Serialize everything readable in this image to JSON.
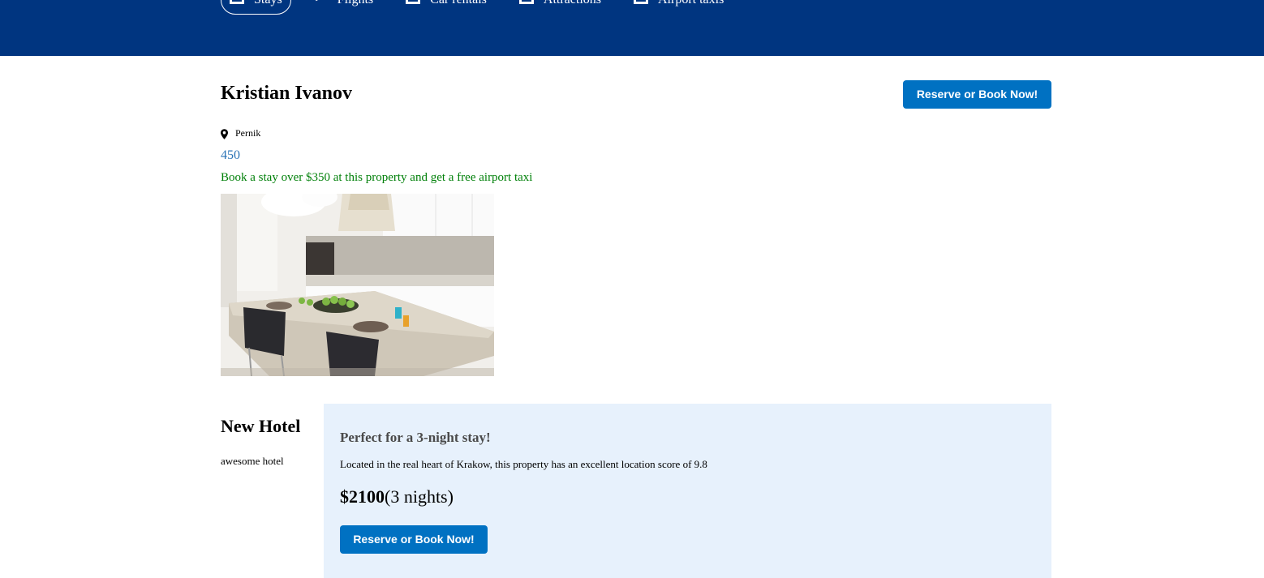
{
  "nav": {
    "items": [
      {
        "label": "Stays",
        "icon": "bed-icon",
        "active": true
      },
      {
        "label": "Flights",
        "icon": "plane-icon",
        "active": false
      },
      {
        "label": "Car rentals",
        "icon": "car-icon",
        "active": false
      },
      {
        "label": "Attractions",
        "icon": "attraction-icon",
        "active": false
      },
      {
        "label": "Airport taxis",
        "icon": "taxi-icon",
        "active": false
      }
    ]
  },
  "hotel": {
    "name": "Kristian Ivanov",
    "reserve_label": "Reserve or Book Now!",
    "location": "Pernik",
    "price": "450",
    "promo": "Book a stay over $350 at this property and get a free airport taxi"
  },
  "second": {
    "name": "New Hotel",
    "description": "awesome hotel"
  },
  "offer": {
    "title": "Perfect for a 3-night stay!",
    "description": "Located in the real heart of Krakow, this property has an excellent location score of 9.8",
    "price": "$2100",
    "nights": "(3 nights)",
    "reserve_label": "Reserve or Book Now!"
  },
  "colors": {
    "header": "#003580",
    "button": "#0071c2",
    "promo": "#008009",
    "offer_bg": "#e7f1fc"
  }
}
